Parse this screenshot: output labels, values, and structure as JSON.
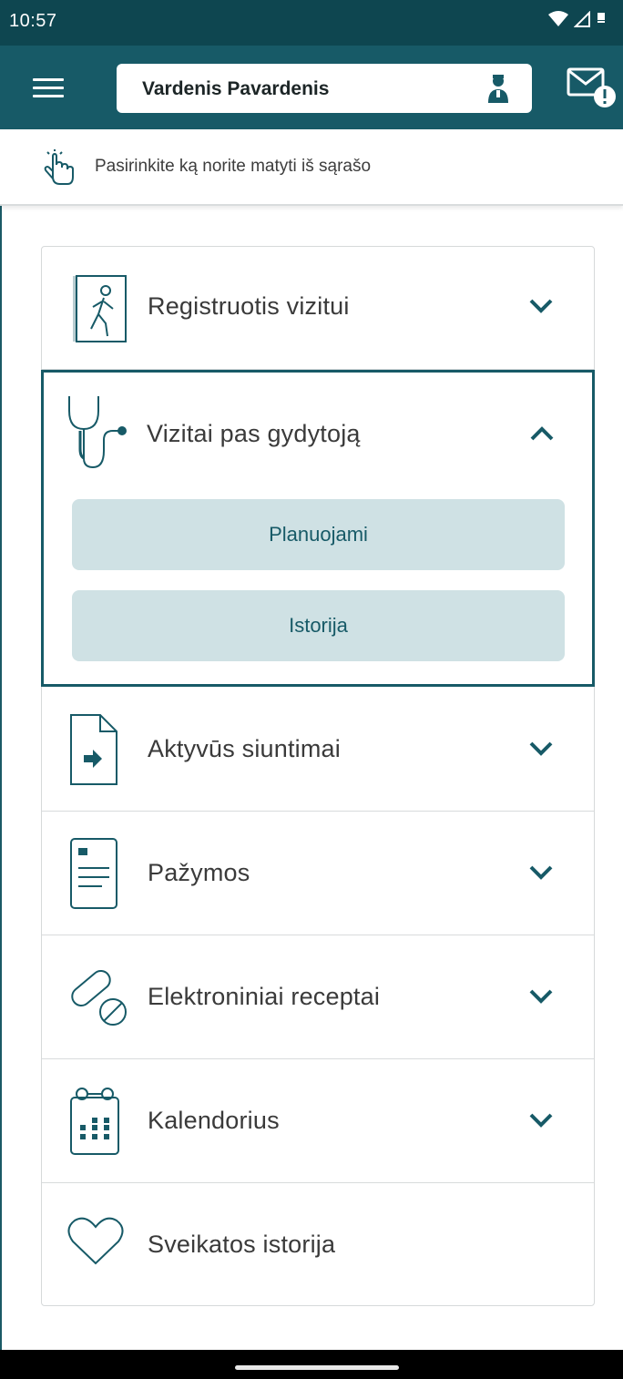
{
  "status_bar": {
    "time": "10:57"
  },
  "header": {
    "user_name": "Vardenis Pavardenis",
    "user_icon": "doctor-avatar-icon",
    "menu_icon": "hamburger-menu-icon",
    "mail_icon": "mail-alert-icon"
  },
  "hint": {
    "icon": "tap-hand-icon",
    "text": "Pasirinkite ką norite matyti iš sąrašo"
  },
  "menu": {
    "items": [
      {
        "label": "Registruotis vizitui",
        "icon": "walking-person-door-icon",
        "expanded": false
      },
      {
        "label": "Vizitai pas gydytoją",
        "icon": "stethoscope-icon",
        "expanded": true,
        "subitems": [
          {
            "label": "Planuojami"
          },
          {
            "label": "Istorija"
          }
        ]
      },
      {
        "label": "Aktyvūs siuntimai",
        "icon": "document-arrow-icon",
        "expanded": false
      },
      {
        "label": "Pažymos",
        "icon": "certificate-document-icon",
        "expanded": false
      },
      {
        "label": "Elektroniniai receptai",
        "icon": "pill-icon",
        "expanded": false
      },
      {
        "label": "Kalendorius",
        "icon": "calendar-icon",
        "expanded": false
      },
      {
        "label": "Sveikatos istorija",
        "icon": "heart-icon",
        "expanded": false
      }
    ]
  },
  "colors": {
    "status_bar": "#0e4650",
    "app_bar": "#175a67",
    "accent": "#175a67",
    "sub_button_bg": "#cfe1e4"
  }
}
